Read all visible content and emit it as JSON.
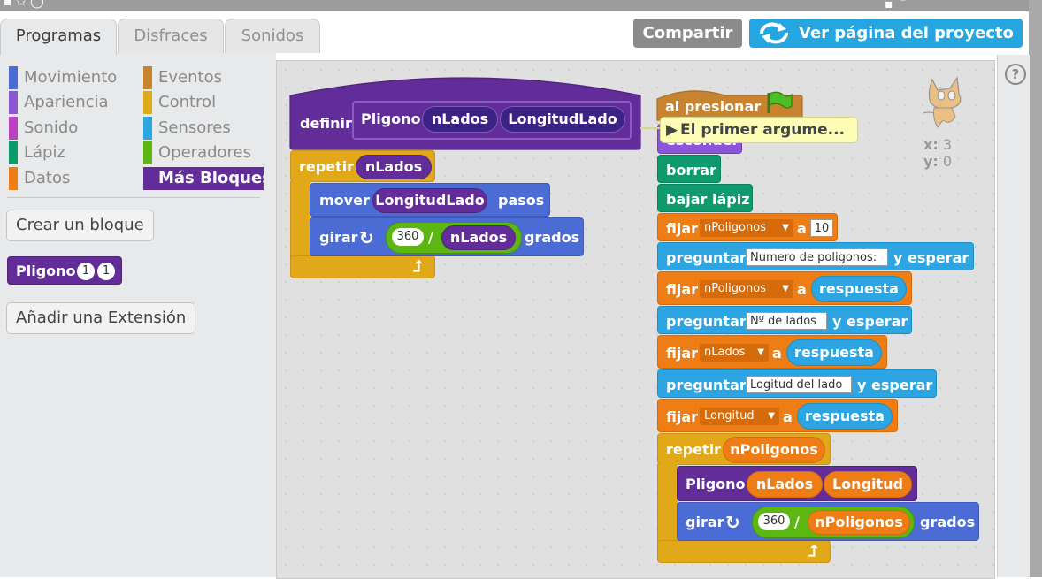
{
  "tabs": [
    "Programas",
    "Disfraces",
    "Sonidos"
  ],
  "header": {
    "share": "Compartir",
    "project_page": "Ver página del proyecto"
  },
  "categories": {
    "left": [
      "Movimiento",
      "Apariencia",
      "Sonido",
      "Lápiz",
      "Datos"
    ],
    "right": [
      "Eventos",
      "Control",
      "Sensores",
      "Operadores",
      "Más Bloques"
    ]
  },
  "category_colors": [
    "#4a6cd4",
    "#8a55d7",
    "#bb42c3",
    "#0e9a6c",
    "#ee7d16",
    "#c88330",
    "#e1a91a",
    "#2ca5e2",
    "#5cb712",
    "#632d99"
  ],
  "palette": {
    "create_block": "Crear un bloque",
    "custom_block": "Pligono",
    "custom_args": [
      "1",
      "1"
    ],
    "add_extension": "Añadir una Extensión"
  },
  "sprite": {
    "x_label": "x:",
    "x": "3",
    "y_label": "y:",
    "y": "0"
  },
  "help": "?",
  "script1": {
    "define": "definir",
    "name": "Pligono",
    "arg1": "nLados",
    "arg2": "LongitudLado",
    "repeat": "repetir",
    "repeat_arg": "nLados",
    "move": "mover",
    "move_arg": "LongitudLado",
    "move_suffix": "pasos",
    "turn": "girar",
    "turn_num": "360",
    "turn_op": "/",
    "turn_arg": "nLados",
    "turn_suffix": "grados"
  },
  "script2": {
    "hat": "al presionar",
    "tooltip": "El primer argume...",
    "hide": "esconder",
    "clear": "borrar",
    "pen_down": "bajar lápiz",
    "set1": {
      "label": "fijar",
      "var": "nPoligonos",
      "to": "a",
      "value": "10"
    },
    "ask1": {
      "label": "preguntar",
      "text": "Numero de poligonos:",
      "suffix": "y esperar"
    },
    "set2": {
      "label": "fijar",
      "var": "nPoligonos",
      "to": "a",
      "value": "respuesta"
    },
    "ask2": {
      "label": "preguntar",
      "text": "Nº de lados",
      "suffix": "y esperar"
    },
    "set3": {
      "label": "fijar",
      "var": "nLados",
      "to": "a",
      "value": "respuesta"
    },
    "ask3": {
      "label": "preguntar",
      "text": "Logitud del lado",
      "suffix": "y esperar"
    },
    "set4": {
      "label": "fijar",
      "var": "Longitud",
      "to": "a",
      "value": "respuesta"
    },
    "repeat": "repetir",
    "repeat_arg": "nPoligonos",
    "call": "Pligono",
    "call_arg1": "nLados",
    "call_arg2": "Longitud",
    "turn": "girar",
    "turn_num": "360",
    "turn_op": "/",
    "turn_arg": "nPoligonos",
    "turn_suffix": "grados"
  }
}
